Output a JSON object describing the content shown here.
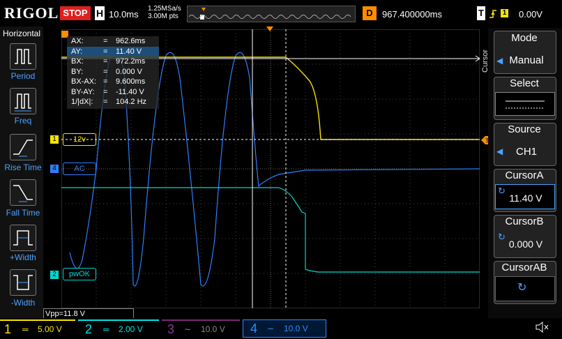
{
  "top": {
    "logo": "RIGOL",
    "run_state": "STOP",
    "horizontal_label": "H",
    "timebase": "10.0ms",
    "sample_rate": "1.25MSa/s",
    "memory_depth": "3.00M pts",
    "delay_label": "D",
    "delay_value": "967.400000ms",
    "trigger_label": "T",
    "trigger_source": "1",
    "trigger_level": "0.00V"
  },
  "left_panel": {
    "title": "Horizontal",
    "items": [
      {
        "label": "Period",
        "icon": "period-icon"
      },
      {
        "label": "Freq",
        "icon": "freq-icon"
      },
      {
        "label": "Rise Time",
        "icon": "rise-time-icon"
      },
      {
        "label": "Fall Time",
        "icon": "fall-time-icon"
      },
      {
        "label": "+Width",
        "icon": "pos-width-icon"
      },
      {
        "label": "-Width",
        "icon": "neg-width-icon"
      }
    ]
  },
  "readout": [
    {
      "key": "AX:",
      "value": "962.6ms"
    },
    {
      "key": "AY:",
      "value": "11.40 V"
    },
    {
      "key": "BX:",
      "value": "972.2ms"
    },
    {
      "key": "BY:",
      "value": "0.000 V"
    },
    {
      "key": "BX-AX:",
      "value": "9.600ms"
    },
    {
      "key": "BY-AY:",
      "value": "-11.40 V"
    },
    {
      "key": "1/|dX|:",
      "value": "104.2 Hz"
    }
  ],
  "channel_labels": {
    "ch1": "12v",
    "ch4": "AC",
    "ch2": "pwOK"
  },
  "vpp": "Vpp=11.8 V",
  "right_panel": {
    "mode_title": "Mode",
    "mode_value": "Manual",
    "select_title": "Select",
    "source_title": "Source",
    "source_value": "CH1",
    "cursor_a_title": "CursorA",
    "cursor_a_value": "11.40 V",
    "cursor_b_title": "CursorB",
    "cursor_b_value": "0.000 V",
    "cursor_ab_title": "CursorAB",
    "side_label": "Cursor"
  },
  "bottom": {
    "ch1": {
      "num": "1",
      "scale": "5.00 V",
      "color": "#f7e400"
    },
    "ch2": {
      "num": "2",
      "scale": "2.00 V",
      "color": "#00e5e5"
    },
    "ch3": {
      "num": "3",
      "scale": "10.0 V",
      "color": "#c040c0"
    },
    "ch4": {
      "num": "4",
      "scale": "10.0 V",
      "color": "#2f8cff"
    }
  },
  "colors": {
    "ch1": "#f7e400",
    "ch2": "#00d8d0",
    "ch4": "#2f7fff",
    "delay": "#ff8c00",
    "stop": "#e0201e"
  }
}
